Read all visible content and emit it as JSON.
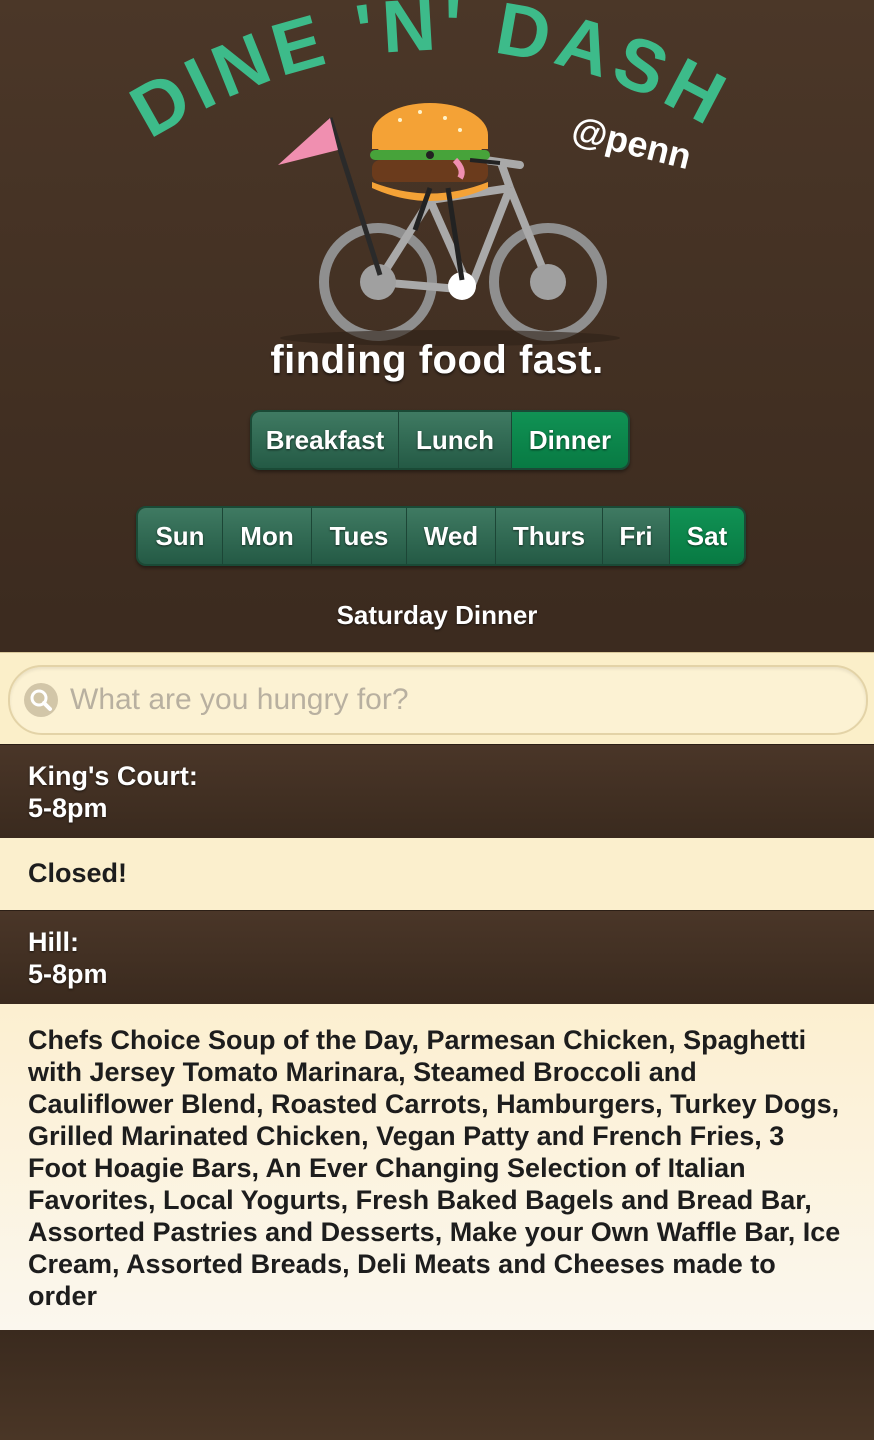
{
  "logo": {
    "title": "DINE 'N' DASH",
    "subtitle": "@penn",
    "tagline": "finding food fast."
  },
  "meals": {
    "items": [
      "Breakfast",
      "Lunch",
      "Dinner"
    ],
    "active": "Dinner"
  },
  "days": {
    "items": [
      "Sun",
      "Mon",
      "Tues",
      "Wed",
      "Thurs",
      "Fri",
      "Sat"
    ],
    "active": "Sat"
  },
  "selection_title": "Saturday Dinner",
  "search": {
    "placeholder": "What are you hungry for?",
    "value": ""
  },
  "locations": [
    {
      "name": "King's Court:",
      "hours": "5-8pm",
      "menu": "Closed!"
    },
    {
      "name": "Hill:",
      "hours": "5-8pm",
      "menu": "Chefs Choice Soup of the Day, Parmesan Chicken, Spaghetti with Jersey Tomato Marinara, Steamed Broccoli and Cauliflower Blend, Roasted Carrots, Hamburgers, Turkey Dogs, Grilled Marinated Chicken, Vegan Patty and French Fries, 3 Foot Hoagie Bars, An Ever Changing Selection of Italian Favorites, Local Yogurts, Fresh Baked Bagels and Bread Bar, Assorted Pastries and Desserts, Make your Own Waffle Bar, Ice Cream, Assorted Breads, Deli Meats and Cheeses made to order"
    }
  ],
  "colors": {
    "brand_green": "#3dbb8a",
    "active_button": "#0b8a4c",
    "background": "#3d2c20",
    "cream": "#fbefcd",
    "flag_pink": "#f08fb0"
  }
}
